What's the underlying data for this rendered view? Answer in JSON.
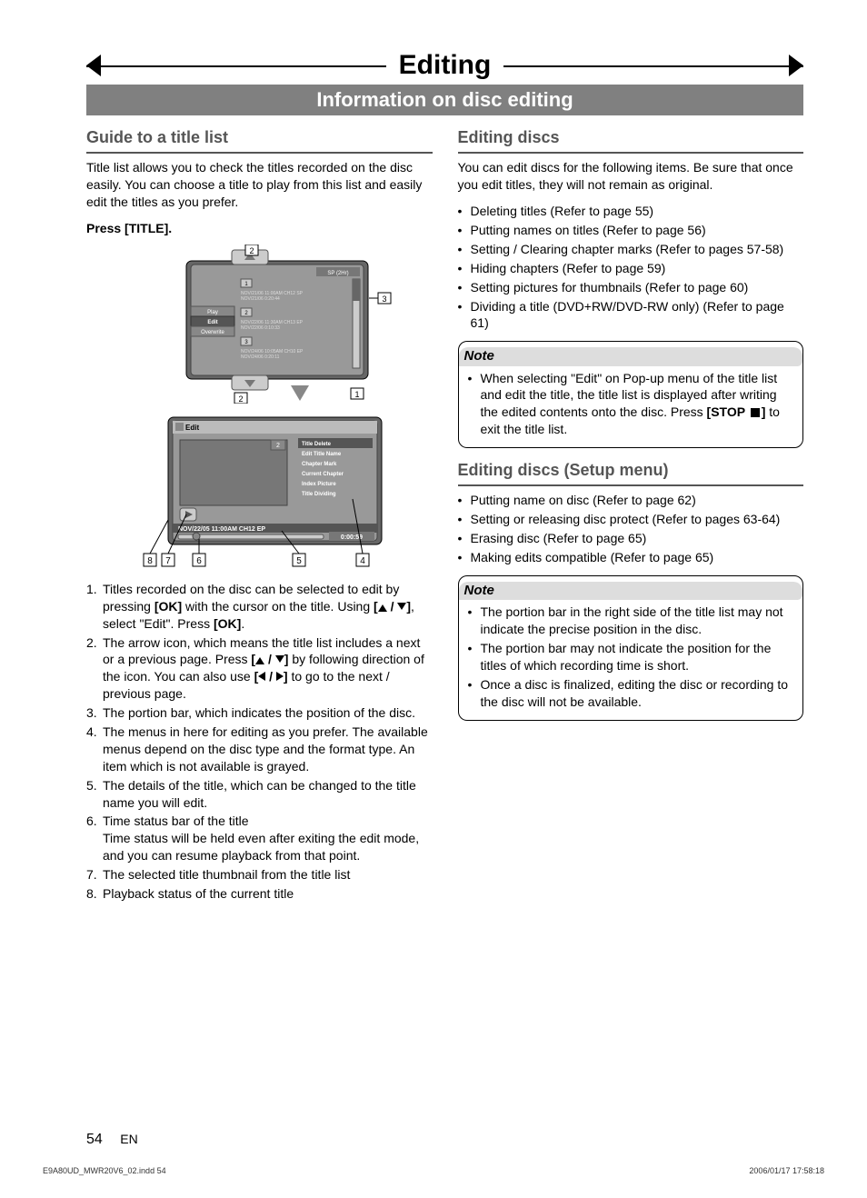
{
  "banner": {
    "title": "Editing",
    "subtitle": "Information on disc editing"
  },
  "left": {
    "heading": "Guide to a title list",
    "intro": "Title list allows you to check the titles recorded on the disc easily. You can choose a title to play from this list and easily edit the titles as you prefer.",
    "press_prefix": "Press ",
    "press_bold": "[TITLE].",
    "fig1": {
      "sp_label": "SP (2Hr)",
      "rows": [
        {
          "n": "1",
          "l1": "NOV/21/06  11:00AM CH12  SP",
          "l2": "NOV/21/06     0:20:44"
        },
        {
          "n": "2",
          "l1": "NOV/22/06  11:30AM CH13  EP",
          "l2": "NOV/22/06     0:10:33"
        },
        {
          "n": "3",
          "l1": "NOV/24/06  10:05AM CH10  EP",
          "l2": "NOV/24/06     0:20:11"
        }
      ],
      "menu": [
        "Play",
        "Edit",
        "Overwrite"
      ],
      "callouts": {
        "top": "2",
        "right": "3",
        "bottom_right": "1",
        "bottom_left": "2"
      }
    },
    "fig2": {
      "edit_label": "Edit",
      "badge": "2",
      "menu": [
        "Title Delete",
        "Edit Title Name",
        "Chapter Mark",
        "Current Chapter",
        "Index Picture",
        "Title Dividing"
      ],
      "detail": "NOV/22/05 11:00AM CH12 EP",
      "time": "0:00:59",
      "callouts": [
        "8",
        "7",
        "6",
        "5",
        "4"
      ]
    },
    "list": [
      {
        "n": "1.",
        "pre": "Titles recorded on the disc can be selected to edit by pressing ",
        "b1": "[OK]",
        "mid1": " with the cursor on the title. Using ",
        "b2": "[",
        "arrows1": true,
        "b2b": "]",
        "mid2": ", select \"Edit\". Press ",
        "b3": "[OK]",
        "post": "."
      },
      {
        "n": "2.",
        "pre": "The arrow icon, which means the title list includes a next or a previous page. Press ",
        "b1": "[",
        "arrows1": true,
        "b1b": "]",
        "mid1": " by following direction of the icon. You can also use ",
        "b2": "[",
        "arrows2": true,
        "b2b": "]",
        "post": " to go to the next / previous page."
      },
      {
        "n": "3.",
        "txt": "The portion bar, which indicates the position of the disc."
      },
      {
        "n": "4.",
        "txt": "The menus in here for editing as you prefer. The available menus depend on the disc type and the format type. An item which is not available is grayed."
      },
      {
        "n": "5.",
        "txt": "The details of the title, which can be changed to the title name you will edit."
      },
      {
        "n": "6.",
        "txt": "Time status bar of the title\nTime status will be held even after exiting the edit mode, and you can resume playback from that point."
      },
      {
        "n": "7.",
        "txt": "The selected title thumbnail from the title list"
      },
      {
        "n": "8.",
        "txt": "Playback status of the current title"
      }
    ]
  },
  "right": {
    "heading1": "Editing discs",
    "intro1": "You can edit discs for the following items. Be sure that once you edit titles, they will not remain as original.",
    "bullets1": [
      "Deleting titles (Refer to page 55)",
      "Putting names on titles (Refer to page 56)",
      "Setting / Clearing chapter marks (Refer to pages 57-58)",
      "Hiding chapters (Refer to page 59)",
      "Setting pictures for thumbnails (Refer to page 60)",
      "Dividing a title (DVD+RW/DVD-RW only) (Refer to page 61)"
    ],
    "note1": {
      "title": "Note",
      "text_pre": "When selecting \"Edit\" on Pop-up menu of the title list and edit the title, the title list is displayed after writing the edited contents onto the disc. Press ",
      "stop_bold": "[STOP ",
      "text_post": "] ",
      "tail": "to exit the title list."
    },
    "heading2": "Editing discs (Setup menu)",
    "bullets2": [
      "Putting name on disc (Refer to page 62)",
      "Setting or releasing disc protect (Refer to pages 63-64)",
      "Erasing disc (Refer to page 65)",
      "Making edits compatible (Refer to page 65)"
    ],
    "note2": {
      "title": "Note",
      "items": [
        "The portion bar in the right side of the title list may not indicate the precise position in the disc.",
        "The portion bar may not indicate the position for the titles of which recording time is short.",
        "Once a disc is finalized, editing the disc or recording to the disc will not be available."
      ]
    }
  },
  "footer": {
    "page": "54",
    "lang": "EN"
  },
  "meta": {
    "file": "E9A80UD_MWR20V6_02.indd   54",
    "date": "2006/01/17   17:58:18"
  }
}
